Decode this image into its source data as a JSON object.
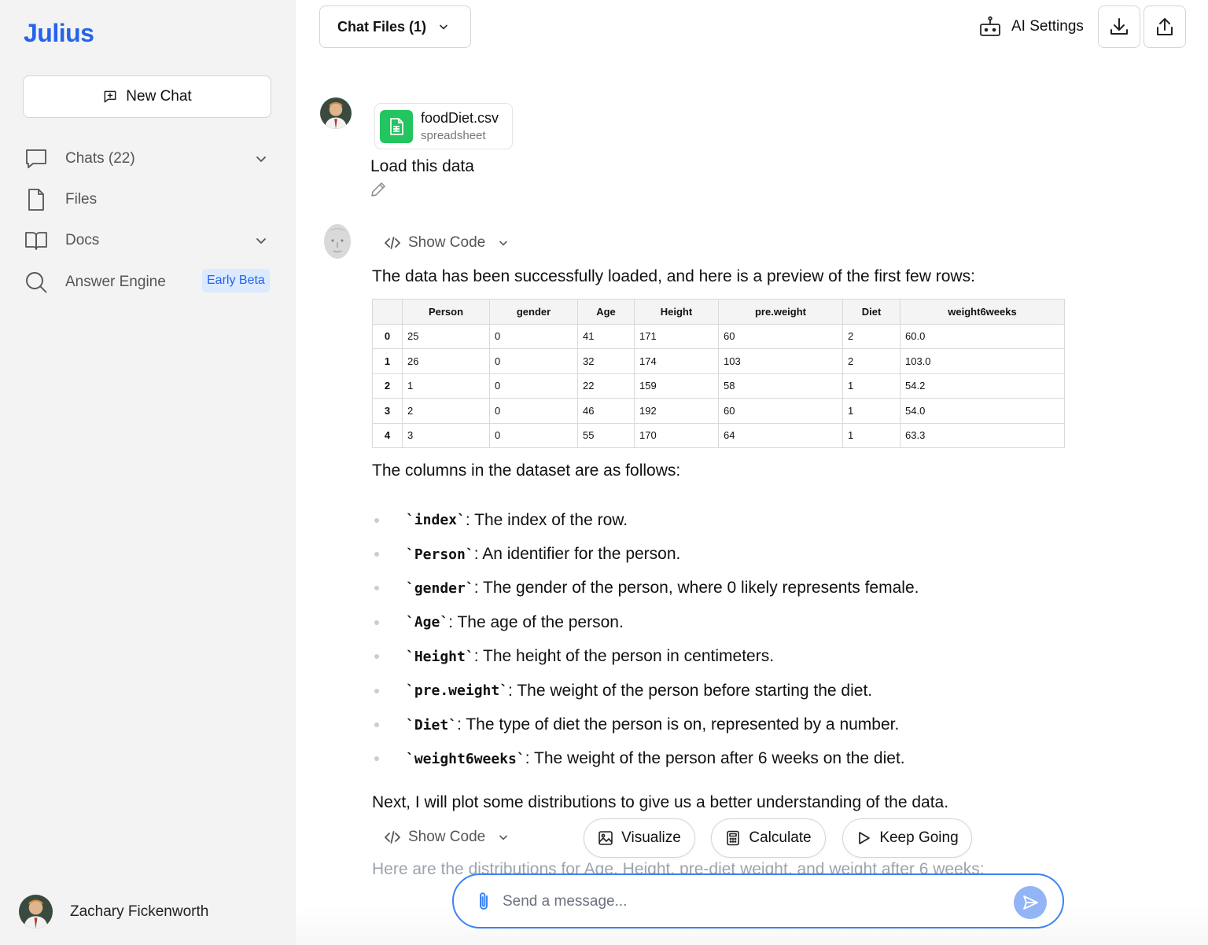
{
  "app": {
    "logo": "Julius"
  },
  "sidebar": {
    "new_chat_label": "New Chat",
    "items": [
      {
        "label": "Chats  (22)",
        "icon": "chat-bubble-icon",
        "has_chevron": true
      },
      {
        "label": "Files",
        "icon": "file-icon",
        "has_chevron": false
      },
      {
        "label": "Docs",
        "icon": "book-icon",
        "has_chevron": true
      },
      {
        "label": "Answer Engine",
        "icon": "search-icon",
        "badge": "Early Beta"
      }
    ],
    "user": {
      "name": "Zachary Fickenworth"
    }
  },
  "header": {
    "chat_files_label": "Chat Files (1)",
    "ai_settings_label": "AI Settings"
  },
  "messages": {
    "attachment": {
      "name": "foodDiet.csv",
      "type": "spreadsheet"
    },
    "user_text": "Load this data",
    "show_code_label": "Show Code",
    "intro": "The data has been successfully loaded, and here is a preview of the first few rows:",
    "table": {
      "headers": [
        "",
        "Person",
        "gender",
        "Age",
        "Height",
        "pre.weight",
        "Diet",
        "weight6weeks"
      ],
      "rows": [
        [
          "0",
          "25",
          "0",
          "41",
          "171",
          "60",
          "2",
          "60.0"
        ],
        [
          "1",
          "26",
          "0",
          "32",
          "174",
          "103",
          "2",
          "103.0"
        ],
        [
          "2",
          "1",
          "0",
          "22",
          "159",
          "58",
          "1",
          "54.2"
        ],
        [
          "3",
          "2",
          "0",
          "46",
          "192",
          "60",
          "1",
          "54.0"
        ],
        [
          "4",
          "3",
          "0",
          "55",
          "170",
          "64",
          "1",
          "63.3"
        ]
      ]
    },
    "columns_intro": "The columns in the dataset are as follows:",
    "columns": [
      {
        "name": "`index`",
        "desc": ": The index of the row."
      },
      {
        "name": "`Person`",
        "desc": ": An identifier for the person."
      },
      {
        "name": "`gender`",
        "desc": ": The gender of the person, where 0 likely represents female."
      },
      {
        "name": "`Age`",
        "desc": ": The age of the person."
      },
      {
        "name": "`Height`",
        "desc": ": The height of the person in centimeters."
      },
      {
        "name": "`pre.weight`",
        "desc": ": The weight of the person before starting the diet."
      },
      {
        "name": "`Diet`",
        "desc": ": The type of diet the person is on, represented by a number."
      },
      {
        "name": "`weight6weeks`",
        "desc": ": The weight of the person after 6 weeks on the diet."
      }
    ],
    "next_text": "Next, I will plot some distributions to give us a better understanding of the data.",
    "faded_text": "Here are the distributions for Age, Height, pre-diet weight, and weight after 6 weeks:"
  },
  "actions": {
    "visualize": "Visualize",
    "calculate": "Calculate",
    "keep_going": "Keep Going"
  },
  "composer": {
    "placeholder": "Send a message..."
  },
  "colors": {
    "accent": "#2563eb",
    "file_green": "#22c55e",
    "badge_bg": "#dbeafe",
    "send_bg": "#93b4f5"
  }
}
